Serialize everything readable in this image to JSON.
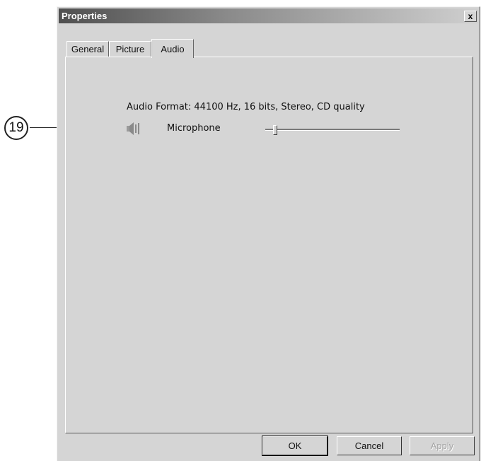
{
  "callout": {
    "number": "19"
  },
  "window": {
    "title": "Properties",
    "close_label": "x"
  },
  "tabs": [
    {
      "label": "General",
      "active": false
    },
    {
      "label": "Picture",
      "active": false
    },
    {
      "label": "Audio",
      "active": true
    }
  ],
  "audio": {
    "format_text": "Audio Format: 44100 Hz, 16 bits, Stereo, CD quality",
    "microphone_label": "Microphone",
    "microphone_level": 0.06
  },
  "buttons": {
    "ok": "OK",
    "cancel": "Cancel",
    "apply": "Apply"
  },
  "icons": {
    "speaker": "speaker-icon",
    "close": "close-icon"
  }
}
